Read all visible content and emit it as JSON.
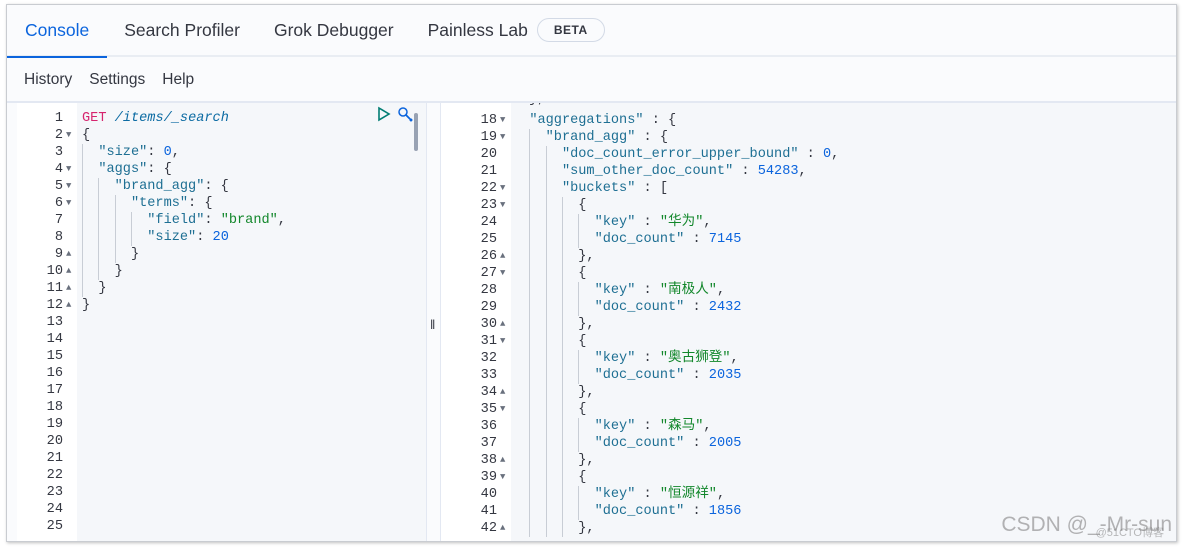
{
  "tabs": [
    {
      "label": "Console",
      "active": true
    },
    {
      "label": "Search Profiler"
    },
    {
      "label": "Grok Debugger"
    },
    {
      "label": "Painless Lab"
    }
  ],
  "beta_badge": "BETA",
  "toolbar": {
    "history": "History",
    "settings": "Settings",
    "help": "Help"
  },
  "divider_handle": "‖",
  "request": {
    "lines": [
      {
        "n": "1",
        "fold": "",
        "ind": 0,
        "tok": [
          [
            "method",
            "GET"
          ],
          [
            "punc",
            " "
          ],
          [
            "url",
            "/items/_search"
          ]
        ]
      },
      {
        "n": "2",
        "fold": "down",
        "ind": 0,
        "tok": [
          [
            "punc",
            "{"
          ]
        ]
      },
      {
        "n": "3",
        "fold": "",
        "ind": 1,
        "tok": [
          [
            "key",
            "\"size\""
          ],
          [
            "punc",
            ": "
          ],
          [
            "num",
            "0"
          ],
          [
            "punc",
            ","
          ]
        ]
      },
      {
        "n": "4",
        "fold": "down",
        "ind": 1,
        "tok": [
          [
            "key",
            "\"aggs\""
          ],
          [
            "punc",
            ": {"
          ]
        ]
      },
      {
        "n": "5",
        "fold": "down",
        "ind": 2,
        "tok": [
          [
            "key",
            "\"brand_agg\""
          ],
          [
            "punc",
            ": {"
          ]
        ]
      },
      {
        "n": "6",
        "fold": "down",
        "ind": 3,
        "tok": [
          [
            "key",
            "\"terms\""
          ],
          [
            "punc",
            ": {"
          ]
        ]
      },
      {
        "n": "7",
        "fold": "",
        "ind": 4,
        "tok": [
          [
            "key",
            "\"field\""
          ],
          [
            "punc",
            ": "
          ],
          [
            "str",
            "\"brand\""
          ],
          [
            "punc",
            ","
          ]
        ]
      },
      {
        "n": "8",
        "fold": "",
        "ind": 4,
        "tok": [
          [
            "key",
            "\"size\""
          ],
          [
            "punc",
            ": "
          ],
          [
            "num",
            "20"
          ]
        ]
      },
      {
        "n": "9",
        "fold": "up",
        "ind": 3,
        "tok": [
          [
            "punc",
            "}"
          ]
        ]
      },
      {
        "n": "10",
        "fold": "up",
        "ind": 2,
        "tok": [
          [
            "punc",
            "}"
          ]
        ]
      },
      {
        "n": "11",
        "fold": "up",
        "ind": 1,
        "tok": [
          [
            "punc",
            "}"
          ]
        ]
      },
      {
        "n": "12",
        "fold": "up",
        "ind": 0,
        "tok": [
          [
            "punc",
            "}"
          ]
        ]
      },
      {
        "n": "13"
      },
      {
        "n": "14"
      },
      {
        "n": "15"
      },
      {
        "n": "16"
      },
      {
        "n": "17"
      },
      {
        "n": "18"
      },
      {
        "n": "19"
      },
      {
        "n": "20"
      },
      {
        "n": "21"
      },
      {
        "n": "22"
      },
      {
        "n": "23"
      },
      {
        "n": "24"
      },
      {
        "n": "25"
      }
    ],
    "run_icon": "play-icon",
    "wrench_icon": "wrench-icon"
  },
  "response": {
    "lines": [
      {
        "n": "18",
        "fold": "down",
        "ind": 1,
        "tok": [
          [
            "key",
            "\"aggregations\""
          ],
          [
            "punc",
            " : {"
          ]
        ]
      },
      {
        "n": "19",
        "fold": "down",
        "ind": 2,
        "tok": [
          [
            "key",
            "\"brand_agg\""
          ],
          [
            "punc",
            " : {"
          ]
        ]
      },
      {
        "n": "20",
        "fold": "",
        "ind": 3,
        "tok": [
          [
            "key",
            "\"doc_count_error_upper_bound\""
          ],
          [
            "punc",
            " : "
          ],
          [
            "num",
            "0"
          ],
          [
            "punc",
            ","
          ]
        ]
      },
      {
        "n": "21",
        "fold": "",
        "ind": 3,
        "tok": [
          [
            "key",
            "\"sum_other_doc_count\""
          ],
          [
            "punc",
            " : "
          ],
          [
            "num",
            "54283"
          ],
          [
            "punc",
            ","
          ]
        ]
      },
      {
        "n": "22",
        "fold": "down",
        "ind": 3,
        "tok": [
          [
            "key",
            "\"buckets\""
          ],
          [
            "punc",
            " : ["
          ]
        ]
      },
      {
        "n": "23",
        "fold": "down",
        "ind": 4,
        "tok": [
          [
            "punc",
            "{"
          ]
        ]
      },
      {
        "n": "24",
        "fold": "",
        "ind": 5,
        "tok": [
          [
            "key",
            "\"key\""
          ],
          [
            "punc",
            " : "
          ],
          [
            "str",
            "\"华为\""
          ],
          [
            "punc",
            ","
          ]
        ]
      },
      {
        "n": "25",
        "fold": "",
        "ind": 5,
        "tok": [
          [
            "key",
            "\"doc_count\""
          ],
          [
            "punc",
            " : "
          ],
          [
            "num",
            "7145"
          ]
        ]
      },
      {
        "n": "26",
        "fold": "up",
        "ind": 4,
        "tok": [
          [
            "punc",
            "},"
          ]
        ]
      },
      {
        "n": "27",
        "fold": "down",
        "ind": 4,
        "tok": [
          [
            "punc",
            "{"
          ]
        ]
      },
      {
        "n": "28",
        "fold": "",
        "ind": 5,
        "tok": [
          [
            "key",
            "\"key\""
          ],
          [
            "punc",
            " : "
          ],
          [
            "str",
            "\"南极人\""
          ],
          [
            "punc",
            ","
          ]
        ]
      },
      {
        "n": "29",
        "fold": "",
        "ind": 5,
        "tok": [
          [
            "key",
            "\"doc_count\""
          ],
          [
            "punc",
            " : "
          ],
          [
            "num",
            "2432"
          ]
        ]
      },
      {
        "n": "30",
        "fold": "up",
        "ind": 4,
        "tok": [
          [
            "punc",
            "},"
          ]
        ]
      },
      {
        "n": "31",
        "fold": "down",
        "ind": 4,
        "tok": [
          [
            "punc",
            "{"
          ]
        ]
      },
      {
        "n": "32",
        "fold": "",
        "ind": 5,
        "tok": [
          [
            "key",
            "\"key\""
          ],
          [
            "punc",
            " : "
          ],
          [
            "str",
            "\"奥古狮登\""
          ],
          [
            "punc",
            ","
          ]
        ]
      },
      {
        "n": "33",
        "fold": "",
        "ind": 5,
        "tok": [
          [
            "key",
            "\"doc_count\""
          ],
          [
            "punc",
            " : "
          ],
          [
            "num",
            "2035"
          ]
        ]
      },
      {
        "n": "34",
        "fold": "up",
        "ind": 4,
        "tok": [
          [
            "punc",
            "},"
          ]
        ]
      },
      {
        "n": "35",
        "fold": "down",
        "ind": 4,
        "tok": [
          [
            "punc",
            "{"
          ]
        ]
      },
      {
        "n": "36",
        "fold": "",
        "ind": 5,
        "tok": [
          [
            "key",
            "\"key\""
          ],
          [
            "punc",
            " : "
          ],
          [
            "str",
            "\"森马\""
          ],
          [
            "punc",
            ","
          ]
        ]
      },
      {
        "n": "37",
        "fold": "",
        "ind": 5,
        "tok": [
          [
            "key",
            "\"doc_count\""
          ],
          [
            "punc",
            " : "
          ],
          [
            "num",
            "2005"
          ]
        ]
      },
      {
        "n": "38",
        "fold": "up",
        "ind": 4,
        "tok": [
          [
            "punc",
            "},"
          ]
        ]
      },
      {
        "n": "39",
        "fold": "down",
        "ind": 4,
        "tok": [
          [
            "punc",
            "{"
          ]
        ]
      },
      {
        "n": "40",
        "fold": "",
        "ind": 5,
        "tok": [
          [
            "key",
            "\"key\""
          ],
          [
            "punc",
            " : "
          ],
          [
            "str",
            "\"恒源祥\""
          ],
          [
            "punc",
            ","
          ]
        ]
      },
      {
        "n": "41",
        "fold": "",
        "ind": 5,
        "tok": [
          [
            "key",
            "\"doc_count\""
          ],
          [
            "punc",
            " : "
          ],
          [
            "num",
            "1856"
          ]
        ]
      },
      {
        "n": "42",
        "fold": "up",
        "ind": 4,
        "tok": [
          [
            "punc",
            "},"
          ]
        ]
      }
    ]
  },
  "watermark": "CSDN @_-Mr-sun",
  "watermark2": "@51CTO博客"
}
